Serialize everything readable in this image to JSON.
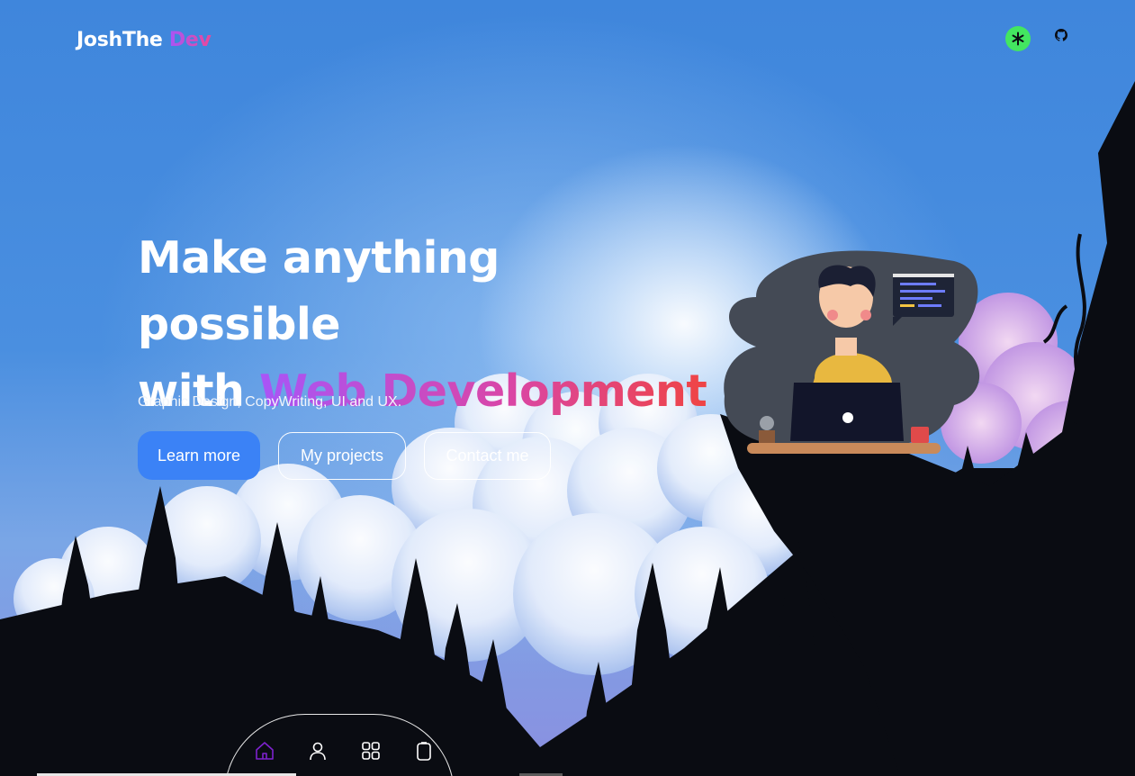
{
  "header": {
    "logo_main": "JoshThe",
    "logo_accent": "Dev",
    "icons": [
      "linktree-icon",
      "github-icon"
    ]
  },
  "hero": {
    "title_line1": "Make anything possible",
    "title_prefix": "with",
    "title_highlight": "Web Development",
    "subtitle": "Graphic Design, CopyWriting, UI and UX."
  },
  "buttons": {
    "learn_more": "Learn more",
    "my_projects": "My projects",
    "contact_me": "Contact me"
  },
  "bottom_nav": {
    "items": [
      "home-icon",
      "user-icon",
      "grid-icon",
      "clipboard-icon"
    ],
    "active": "home-icon"
  },
  "colors": {
    "primary_button": "#3b82f6",
    "gradient_start": "#a855f7",
    "gradient_end": "#ef4444",
    "linktree_green": "#43e660",
    "nav_active": "#7e22ce",
    "silhouette": "#0a0c12"
  }
}
